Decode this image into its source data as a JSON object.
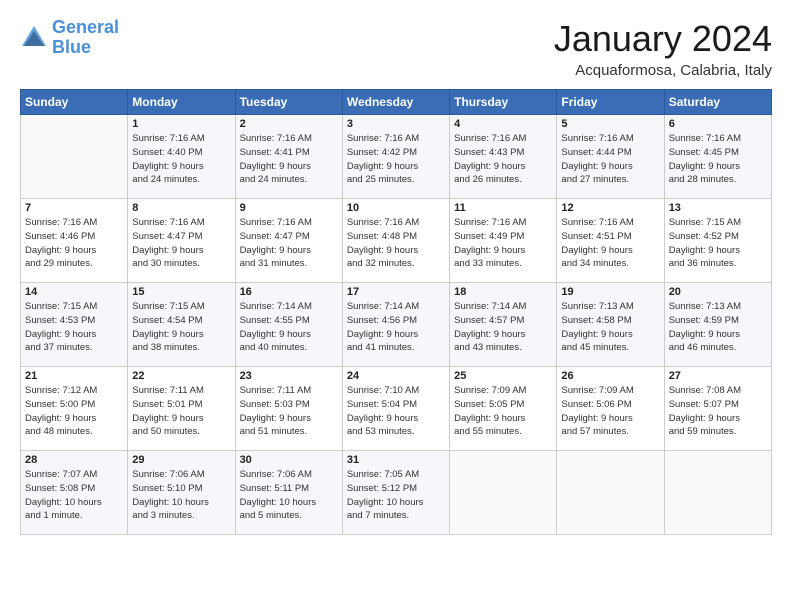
{
  "header": {
    "logo_general": "General",
    "logo_blue": "Blue",
    "month_title": "January 2024",
    "location": "Acquaformosa, Calabria, Italy"
  },
  "weekdays": [
    "Sunday",
    "Monday",
    "Tuesday",
    "Wednesday",
    "Thursday",
    "Friday",
    "Saturday"
  ],
  "weeks": [
    [
      {
        "day": "",
        "info": ""
      },
      {
        "day": "1",
        "info": "Sunrise: 7:16 AM\nSunset: 4:40 PM\nDaylight: 9 hours\nand 24 minutes."
      },
      {
        "day": "2",
        "info": "Sunrise: 7:16 AM\nSunset: 4:41 PM\nDaylight: 9 hours\nand 24 minutes."
      },
      {
        "day": "3",
        "info": "Sunrise: 7:16 AM\nSunset: 4:42 PM\nDaylight: 9 hours\nand 25 minutes."
      },
      {
        "day": "4",
        "info": "Sunrise: 7:16 AM\nSunset: 4:43 PM\nDaylight: 9 hours\nand 26 minutes."
      },
      {
        "day": "5",
        "info": "Sunrise: 7:16 AM\nSunset: 4:44 PM\nDaylight: 9 hours\nand 27 minutes."
      },
      {
        "day": "6",
        "info": "Sunrise: 7:16 AM\nSunset: 4:45 PM\nDaylight: 9 hours\nand 28 minutes."
      }
    ],
    [
      {
        "day": "7",
        "info": "Sunrise: 7:16 AM\nSunset: 4:46 PM\nDaylight: 9 hours\nand 29 minutes."
      },
      {
        "day": "8",
        "info": "Sunrise: 7:16 AM\nSunset: 4:47 PM\nDaylight: 9 hours\nand 30 minutes."
      },
      {
        "day": "9",
        "info": "Sunrise: 7:16 AM\nSunset: 4:47 PM\nDaylight: 9 hours\nand 31 minutes."
      },
      {
        "day": "10",
        "info": "Sunrise: 7:16 AM\nSunset: 4:48 PM\nDaylight: 9 hours\nand 32 minutes."
      },
      {
        "day": "11",
        "info": "Sunrise: 7:16 AM\nSunset: 4:49 PM\nDaylight: 9 hours\nand 33 minutes."
      },
      {
        "day": "12",
        "info": "Sunrise: 7:16 AM\nSunset: 4:51 PM\nDaylight: 9 hours\nand 34 minutes."
      },
      {
        "day": "13",
        "info": "Sunrise: 7:15 AM\nSunset: 4:52 PM\nDaylight: 9 hours\nand 36 minutes."
      }
    ],
    [
      {
        "day": "14",
        "info": "Sunrise: 7:15 AM\nSunset: 4:53 PM\nDaylight: 9 hours\nand 37 minutes."
      },
      {
        "day": "15",
        "info": "Sunrise: 7:15 AM\nSunset: 4:54 PM\nDaylight: 9 hours\nand 38 minutes."
      },
      {
        "day": "16",
        "info": "Sunrise: 7:14 AM\nSunset: 4:55 PM\nDaylight: 9 hours\nand 40 minutes."
      },
      {
        "day": "17",
        "info": "Sunrise: 7:14 AM\nSunset: 4:56 PM\nDaylight: 9 hours\nand 41 minutes."
      },
      {
        "day": "18",
        "info": "Sunrise: 7:14 AM\nSunset: 4:57 PM\nDaylight: 9 hours\nand 43 minutes."
      },
      {
        "day": "19",
        "info": "Sunrise: 7:13 AM\nSunset: 4:58 PM\nDaylight: 9 hours\nand 45 minutes."
      },
      {
        "day": "20",
        "info": "Sunrise: 7:13 AM\nSunset: 4:59 PM\nDaylight: 9 hours\nand 46 minutes."
      }
    ],
    [
      {
        "day": "21",
        "info": "Sunrise: 7:12 AM\nSunset: 5:00 PM\nDaylight: 9 hours\nand 48 minutes."
      },
      {
        "day": "22",
        "info": "Sunrise: 7:11 AM\nSunset: 5:01 PM\nDaylight: 9 hours\nand 50 minutes."
      },
      {
        "day": "23",
        "info": "Sunrise: 7:11 AM\nSunset: 5:03 PM\nDaylight: 9 hours\nand 51 minutes."
      },
      {
        "day": "24",
        "info": "Sunrise: 7:10 AM\nSunset: 5:04 PM\nDaylight: 9 hours\nand 53 minutes."
      },
      {
        "day": "25",
        "info": "Sunrise: 7:09 AM\nSunset: 5:05 PM\nDaylight: 9 hours\nand 55 minutes."
      },
      {
        "day": "26",
        "info": "Sunrise: 7:09 AM\nSunset: 5:06 PM\nDaylight: 9 hours\nand 57 minutes."
      },
      {
        "day": "27",
        "info": "Sunrise: 7:08 AM\nSunset: 5:07 PM\nDaylight: 9 hours\nand 59 minutes."
      }
    ],
    [
      {
        "day": "28",
        "info": "Sunrise: 7:07 AM\nSunset: 5:08 PM\nDaylight: 10 hours\nand 1 minute."
      },
      {
        "day": "29",
        "info": "Sunrise: 7:06 AM\nSunset: 5:10 PM\nDaylight: 10 hours\nand 3 minutes."
      },
      {
        "day": "30",
        "info": "Sunrise: 7:06 AM\nSunset: 5:11 PM\nDaylight: 10 hours\nand 5 minutes."
      },
      {
        "day": "31",
        "info": "Sunrise: 7:05 AM\nSunset: 5:12 PM\nDaylight: 10 hours\nand 7 minutes."
      },
      {
        "day": "",
        "info": ""
      },
      {
        "day": "",
        "info": ""
      },
      {
        "day": "",
        "info": ""
      }
    ]
  ]
}
